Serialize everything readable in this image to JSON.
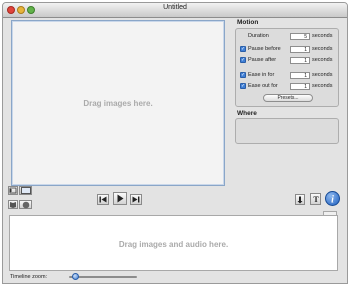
{
  "window": {
    "title": "Untitled"
  },
  "image_drop": {
    "placeholder": "Drag images here."
  },
  "motion": {
    "section_label": "Motion",
    "rows": [
      {
        "label": "Duration",
        "value": "5",
        "unit": "seconds",
        "has_checkbox": false
      },
      {
        "label": "Pause before",
        "value": "1",
        "unit": "seconds",
        "has_checkbox": true,
        "checked": true
      },
      {
        "label": "Pause after",
        "value": "1",
        "unit": "seconds",
        "has_checkbox": true,
        "checked": true
      },
      {
        "label": "Ease in for",
        "value": "1",
        "unit": "seconds",
        "has_checkbox": true,
        "checked": true
      },
      {
        "label": "Ease out for",
        "value": "1",
        "unit": "seconds",
        "has_checkbox": true,
        "checked": true
      }
    ],
    "presets_label": "Presets..."
  },
  "where": {
    "section_label": "Where"
  },
  "timeline": {
    "placeholder": "Drag images and audio here."
  },
  "zoom": {
    "label": "Timeline zoom:",
    "level": 0.05
  },
  "colors": {
    "accent": "#3f7fd6"
  },
  "icons": {
    "rewind": "skip-back-icon",
    "play": "play-icon",
    "forward": "skip-forward-icon",
    "audio": "audio-icon",
    "text": "text-icon",
    "info": "info-icon"
  }
}
